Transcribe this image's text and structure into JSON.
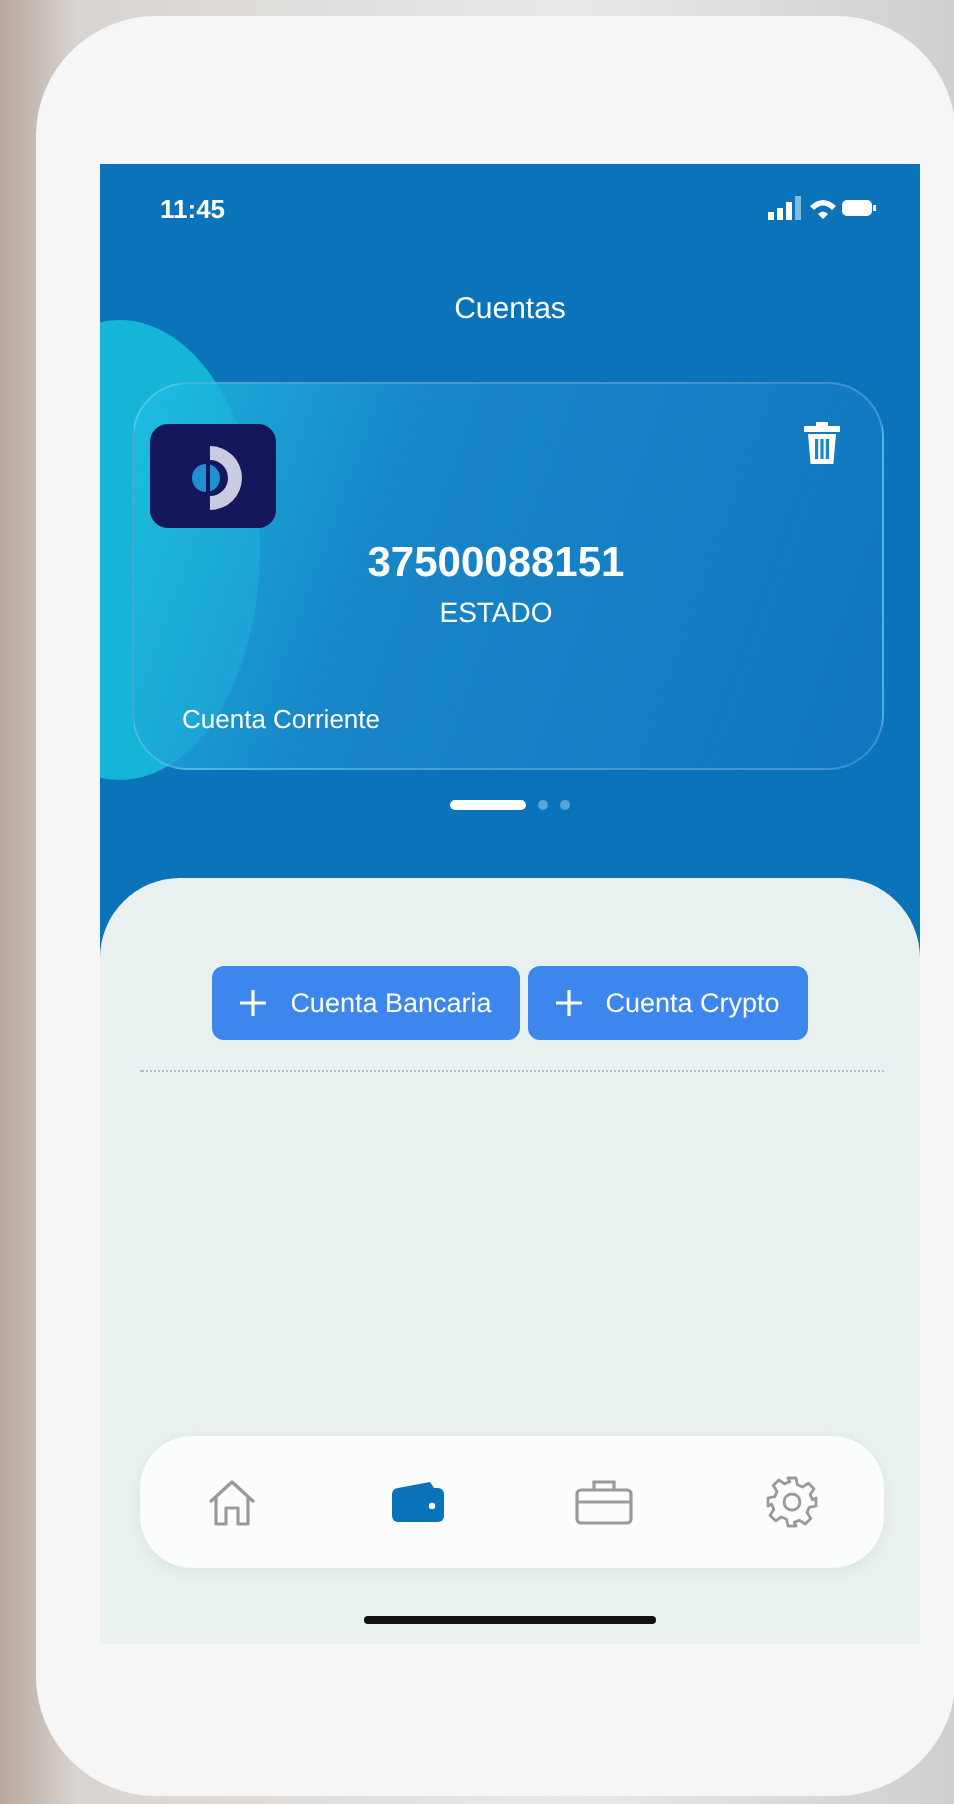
{
  "status_bar": {
    "time": "11:45"
  },
  "header": {
    "title": "Cuentas"
  },
  "accounts": [
    {
      "number": "37500088151",
      "status": "ESTADO",
      "type": "Cuenta Corriente"
    }
  ],
  "pager": [
    {
      "selected": true
    },
    {
      "selected": false
    },
    {
      "selected": false
    }
  ],
  "buttons": [
    {
      "label": "Cuenta Bancaria"
    },
    {
      "label": "Cuenta Crypto"
    }
  ],
  "tab_bar": [
    {
      "kind": "home",
      "selected": false
    },
    {
      "kind": "wallet",
      "selected": true
    },
    {
      "kind": "briefcase",
      "selected": false
    },
    {
      "kind": "settings",
      "selected": false
    }
  ]
}
